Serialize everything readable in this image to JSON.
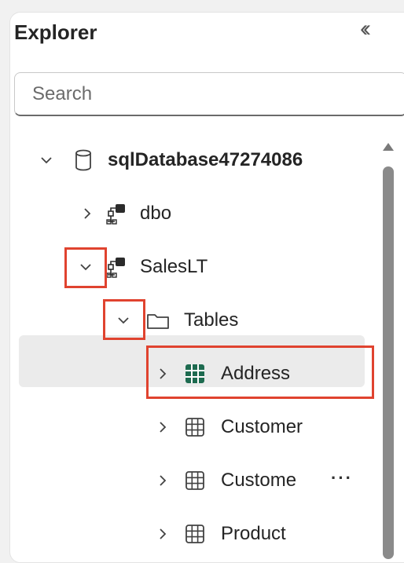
{
  "explorer": {
    "title": "Explorer",
    "collapse_icon": "double-chevron-left-icon",
    "search": {
      "placeholder": "Search",
      "value": ""
    },
    "tree": {
      "database": {
        "label": "sqlDatabase47274086",
        "expanded": true,
        "icon": "database-icon"
      },
      "schemas": [
        {
          "label": "dbo",
          "expanded": false,
          "icon": "schema-icon"
        },
        {
          "label": "SalesLT",
          "expanded": true,
          "icon": "schema-icon"
        }
      ],
      "tables_folder": {
        "label": "Tables",
        "expanded": true,
        "icon": "folder-icon"
      },
      "tables": [
        {
          "label": "Address",
          "selected": true,
          "icon": "table-icon"
        },
        {
          "label": "Customer",
          "selected": false,
          "icon": "table-icon"
        },
        {
          "label": "Custome",
          "selected": false,
          "icon": "table-icon"
        },
        {
          "label": "Product",
          "selected": false,
          "icon": "table-icon"
        }
      ],
      "more_menu_label": "···"
    },
    "colors": {
      "highlight": "#e0432f",
      "table_icon_selected": "#1e6b50",
      "selected_row_bg": "#ebebeb"
    }
  }
}
